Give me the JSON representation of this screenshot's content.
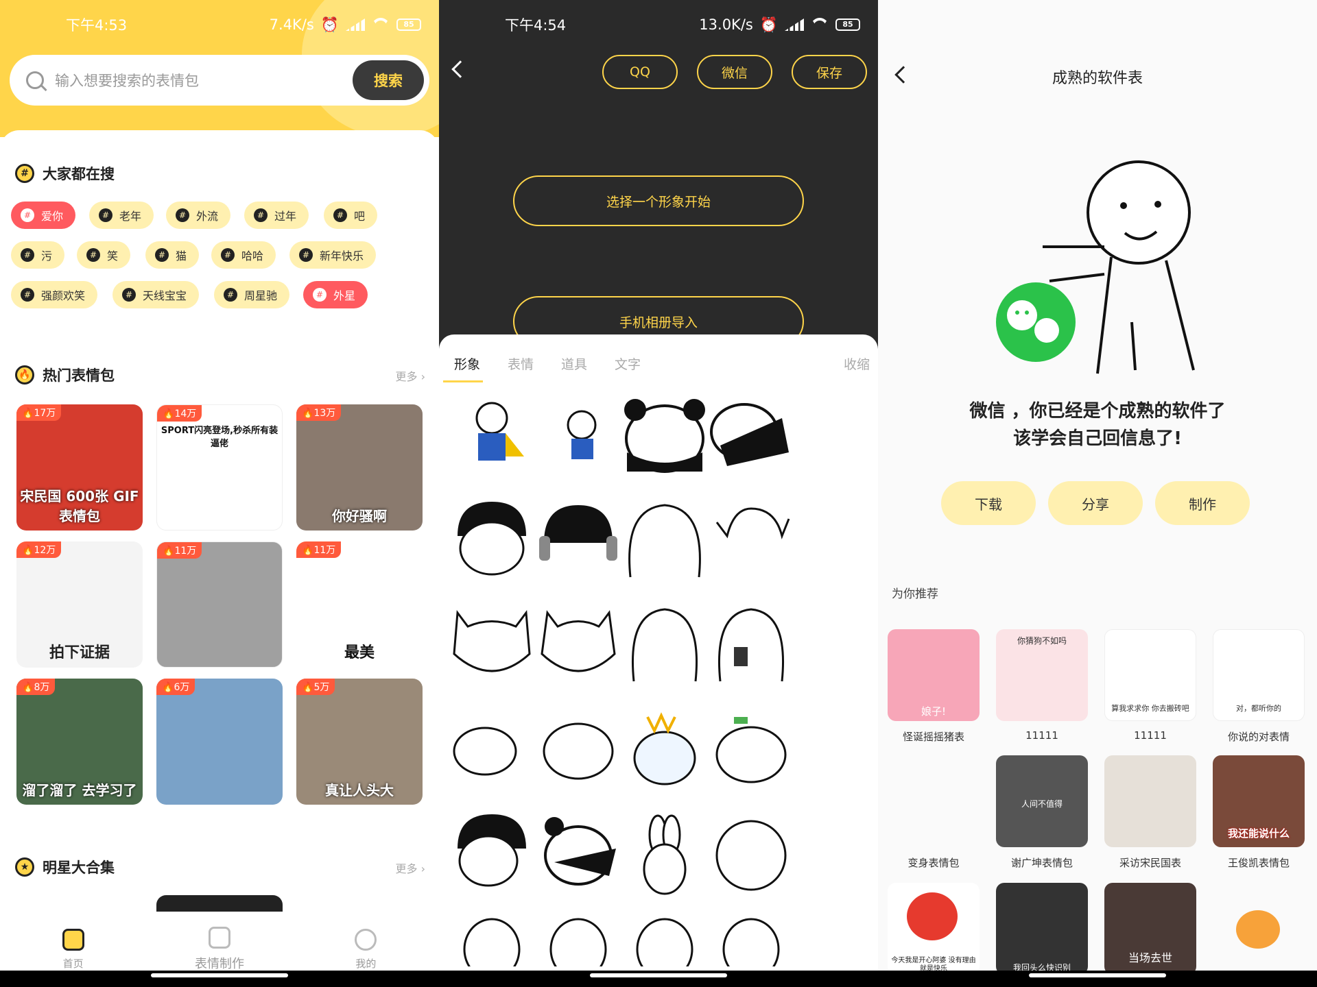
{
  "panel1": {
    "status": {
      "time": "下午4:53",
      "speed": "7.4K/s",
      "battery": "85"
    },
    "search": {
      "placeholder": "输入想要搜索的表情包",
      "button": "搜索"
    },
    "hot_search": {
      "title": "大家都在搜",
      "tags": [
        "爱你",
        "老年",
        "外流",
        "过年",
        "吧",
        "污",
        "笑",
        "猫",
        "哈哈",
        "新年快乐",
        "强颜欢笑",
        "天线宝宝",
        "周星驰",
        "外星"
      ]
    },
    "hot_packs": {
      "title": "热门表情包",
      "more": "更多",
      "items": [
        {
          "badge": "17万",
          "caption": "宋民国 600张 GIF 表情包"
        },
        {
          "badge": "14万",
          "caption": "SPORT闪亮登场,秒杀所有装逼佬"
        },
        {
          "badge": "13万",
          "caption": "你好骚啊"
        },
        {
          "badge": "12万",
          "caption": "拍下证据"
        },
        {
          "badge": "11万",
          "caption": ""
        },
        {
          "badge": "11万",
          "caption": "最美"
        },
        {
          "badge": "8万",
          "caption": "溜了溜了 去学习了"
        },
        {
          "badge": "6万",
          "caption": ""
        },
        {
          "badge": "5万",
          "caption": "真让人头大"
        }
      ]
    },
    "stars": {
      "title": "明星大合集",
      "more": "更多"
    },
    "tabbar": {
      "home": "首页",
      "make": "表情制作",
      "mine": "我的"
    }
  },
  "panel2": {
    "status": {
      "time": "下午4:54",
      "speed": "13.0K/s",
      "battery": "85"
    },
    "actions": {
      "qq": "QQ",
      "wechat": "微信",
      "save": "保存"
    },
    "start": "选择一个形象开始",
    "import": "手机相册导入",
    "tabs": [
      "形象",
      "表情",
      "道具",
      "文字"
    ],
    "collapse": "收缩"
  },
  "panel3": {
    "title": "成熟的软件表",
    "message_line1": "微信 ，你已经是个成熟的软件了",
    "message_line2": "该学会自己回信息了!",
    "buttons": {
      "download": "下载",
      "share": "分享",
      "make": "制作"
    },
    "recommend_title": "为你推荐",
    "recommend_row1": [
      "怪诞摇摇猪表",
      "11111",
      "11111",
      "你说的对表情"
    ],
    "recommend_row2": [
      "变身表情包",
      "谢广坤表情包",
      "采访宋民国表",
      "王俊凯表情包"
    ],
    "tile_texts": {
      "pig": "娘子!",
      "question": "你猜狗不如吗",
      "panda1": "算我求求你 你去搬砖吧",
      "panda2": "对，都听你的",
      "xie": "人间不值得",
      "song": "我还能说什么",
      "apple": "今天我是开心阿婆 没有理由 就是快乐",
      "bald": "当场去世",
      "tang": "我回头么快识别"
    }
  },
  "colors": {
    "accent": "#ffd54a",
    "dark": "#2a2a2a",
    "hot": "#ff5a5f"
  }
}
